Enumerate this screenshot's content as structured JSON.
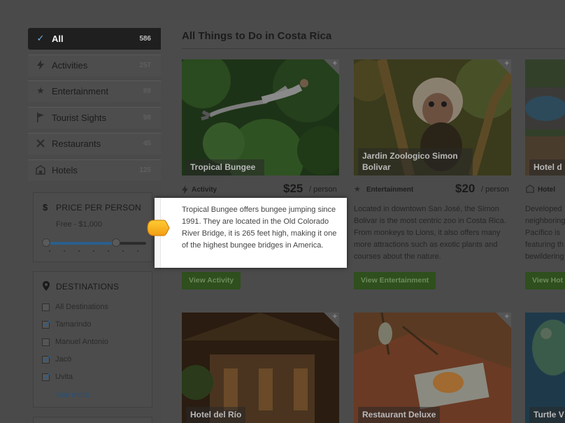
{
  "sidebar": {
    "categories": [
      {
        "label": "All",
        "count": "586",
        "icon": "check-icon"
      },
      {
        "label": "Activities",
        "count": "257",
        "icon": "bolt-icon"
      },
      {
        "label": "Entertainment",
        "count": "89",
        "icon": "star-icon"
      },
      {
        "label": "Tourist Sights",
        "count": "98",
        "icon": "flag-icon"
      },
      {
        "label": "Restaurants",
        "count": "45",
        "icon": "utensils-icon"
      },
      {
        "label": "Hotels",
        "count": "125",
        "icon": "building-icon"
      }
    ],
    "price": {
      "heading": "PRICE PER PERSON",
      "range": "Free - $1,000",
      "slider_low_fraction": 0.0,
      "slider_high_fraction": 0.7
    },
    "destinations": {
      "heading": "DESTINATIONS",
      "items": [
        {
          "label": "All Destinations",
          "checked": false
        },
        {
          "label": "Tamarindo",
          "checked": true
        },
        {
          "label": "Manuel Antonio",
          "checked": false
        },
        {
          "label": "Jacò",
          "checked": true
        },
        {
          "label": "Uvita",
          "checked": true
        }
      ],
      "see_more": "See more",
      "see_more_arrow": "↓"
    }
  },
  "main": {
    "title": "All Things to Do in Costa Rica",
    "cards": [
      {
        "name": "Tropical Bungee",
        "type": "Activity",
        "price": "$25",
        "per": "/ person",
        "description": "Tropical Bungee offers bungee jumping since 1991. They are located in the Old Colorado River Bridge, it is 265 feet high, making it one of the highest bungee bridges in America.",
        "button": "View Activity"
      },
      {
        "name": "Jardin Zoologico Simon Bolivar",
        "type": "Entertainment",
        "price": "$20",
        "per": "/ person",
        "description": "Located in downtown San José, the Simon Bolivar is the most centric zoo in Costa Rica. From monkeys to Lions, it also offers many more attractions such as exotic plants and courses about the nature.",
        "button": "View Entertainment"
      },
      {
        "name": "Hotel d",
        "type": "Hotel",
        "description_lines": [
          "Developed",
          "neighboring",
          "Pacífico is",
          "featuring th",
          "bewildering"
        ],
        "button": "View Hot"
      }
    ],
    "bottom_cards": [
      {
        "name": "Hotel del Río"
      },
      {
        "name": "Restaurant Deluxe"
      },
      {
        "name": "Turtle V"
      }
    ]
  }
}
